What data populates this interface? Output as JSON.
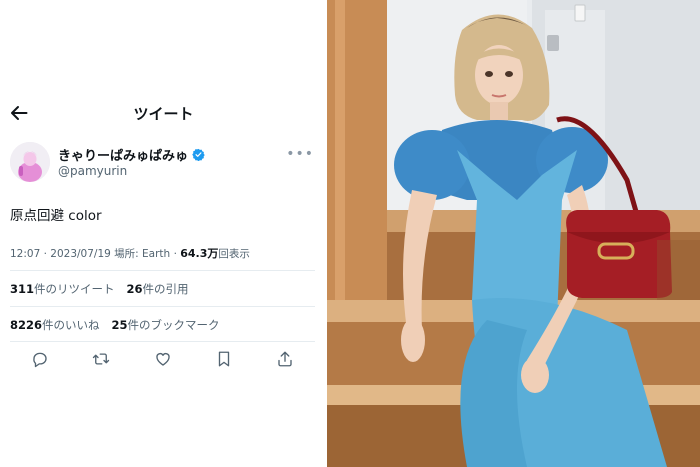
{
  "header": {
    "title": "ツイート"
  },
  "author": {
    "display_name": "きゃりーぱみゅぱみゅ",
    "handle": "@pamyurin"
  },
  "tweet": {
    "text": "原点回避 color",
    "time": "12:07",
    "date": "2023/07/19",
    "location": "場所: Earth",
    "views_count": "64.3万",
    "views_label": "回表示"
  },
  "stats": {
    "retweets_count": "311",
    "retweets_label": "件のリツイート",
    "quotes_count": "26",
    "quotes_label": "件の引用",
    "likes_count": "8226",
    "likes_label": "件のいいね",
    "bookmarks_count": "25",
    "bookmarks_label": "件のブックマーク"
  },
  "colors": {
    "text": "#0f1419",
    "secondary": "#536471",
    "verified": "#1d9bf0",
    "divider": "#e6ecf0",
    "outfit_blue": "#3f93c8",
    "bag_red": "#a51e25"
  }
}
